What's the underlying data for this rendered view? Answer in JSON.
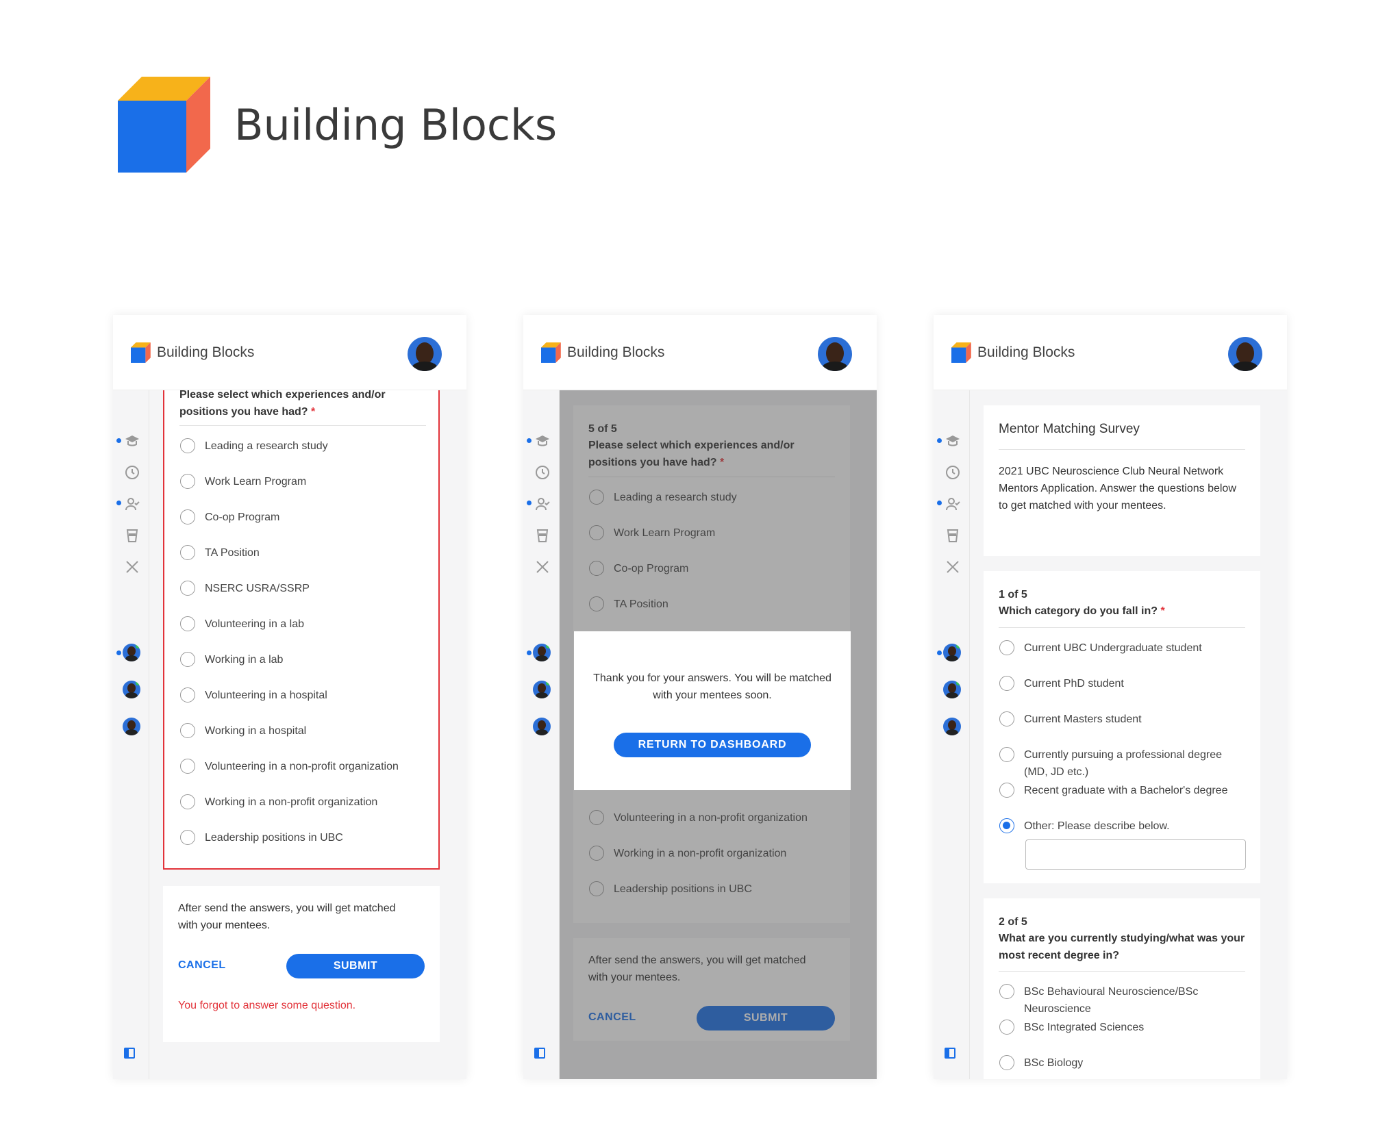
{
  "brand": {
    "title": "Building Blocks",
    "colors": {
      "blue": "#1a6fe8",
      "orange": "#f2684c",
      "yellow": "#f7b21a"
    }
  },
  "app": {
    "name": "Building Blocks"
  },
  "sidebar_icons": [
    "graduation-cap-icon",
    "clock-icon",
    "user-check-icon",
    "cup-icon",
    "utensils-icon"
  ],
  "screen1": {
    "question": {
      "text": "Please select which experiences and/or positions you have had?",
      "required_mark": "*"
    },
    "options": [
      "Leading a research study",
      "Work Learn Program",
      "Co-op Program",
      "TA Position",
      "NSERC USRA/SSRP",
      "Volunteering in a lab",
      "Working in a lab",
      "Volunteering in a hospital",
      "Working in a hospital",
      "Volunteering in a non-profit organization",
      "Working in a non-profit organization",
      "Leadership positions in UBC"
    ],
    "footer": {
      "note": "After send the answers, you will get matched with your mentees.",
      "cancel": "CANCEL",
      "submit": "SUBMIT",
      "error": "You forgot to answer some question."
    }
  },
  "screen2": {
    "question": {
      "num": "5 of 5",
      "text": "Please select which experiences and/or positions you have had?",
      "required_mark": "*"
    },
    "options_top": [
      "Leading a research study",
      "Work Learn Program",
      "Co-op Program",
      "TA Position"
    ],
    "options_bottom": [
      "Volunteering in a non-profit organization",
      "Working in a non-profit organization",
      "Leadership positions in UBC"
    ],
    "modal": {
      "text": "Thank you for your answers. You will be matched with your mentees soon.",
      "button": "RETURN TO DASHBOARD"
    },
    "footer": {
      "note": "After send the answers, you will get matched with your mentees.",
      "cancel": "CANCEL",
      "submit": "SUBMIT"
    }
  },
  "screen3": {
    "survey": {
      "title": "Mentor Matching Survey",
      "description": "2021 UBC Neuroscience Club Neural Network Mentors Application. Answer the questions below to get matched with your mentees."
    },
    "q1": {
      "num": "1 of 5",
      "text": "Which category do you fall in?",
      "required_mark": "*",
      "options": [
        "Current UBC Undergraduate student",
        "Current PhD student",
        "Current Masters student",
        "Currently pursuing a professional degree (MD, JD etc.)",
        "Recent graduate with a Bachelor's degree",
        "Other: Please describe below."
      ],
      "selected_index": 5,
      "other_value": ""
    },
    "q2": {
      "num": "2 of 5",
      "text": "What are you currently studying/what was your most recent degree in?",
      "options": [
        "BSc Behavioural Neuroscience/BSc Neuroscience",
        "BSc Integrated Sciences",
        "BSc Biology"
      ]
    }
  }
}
